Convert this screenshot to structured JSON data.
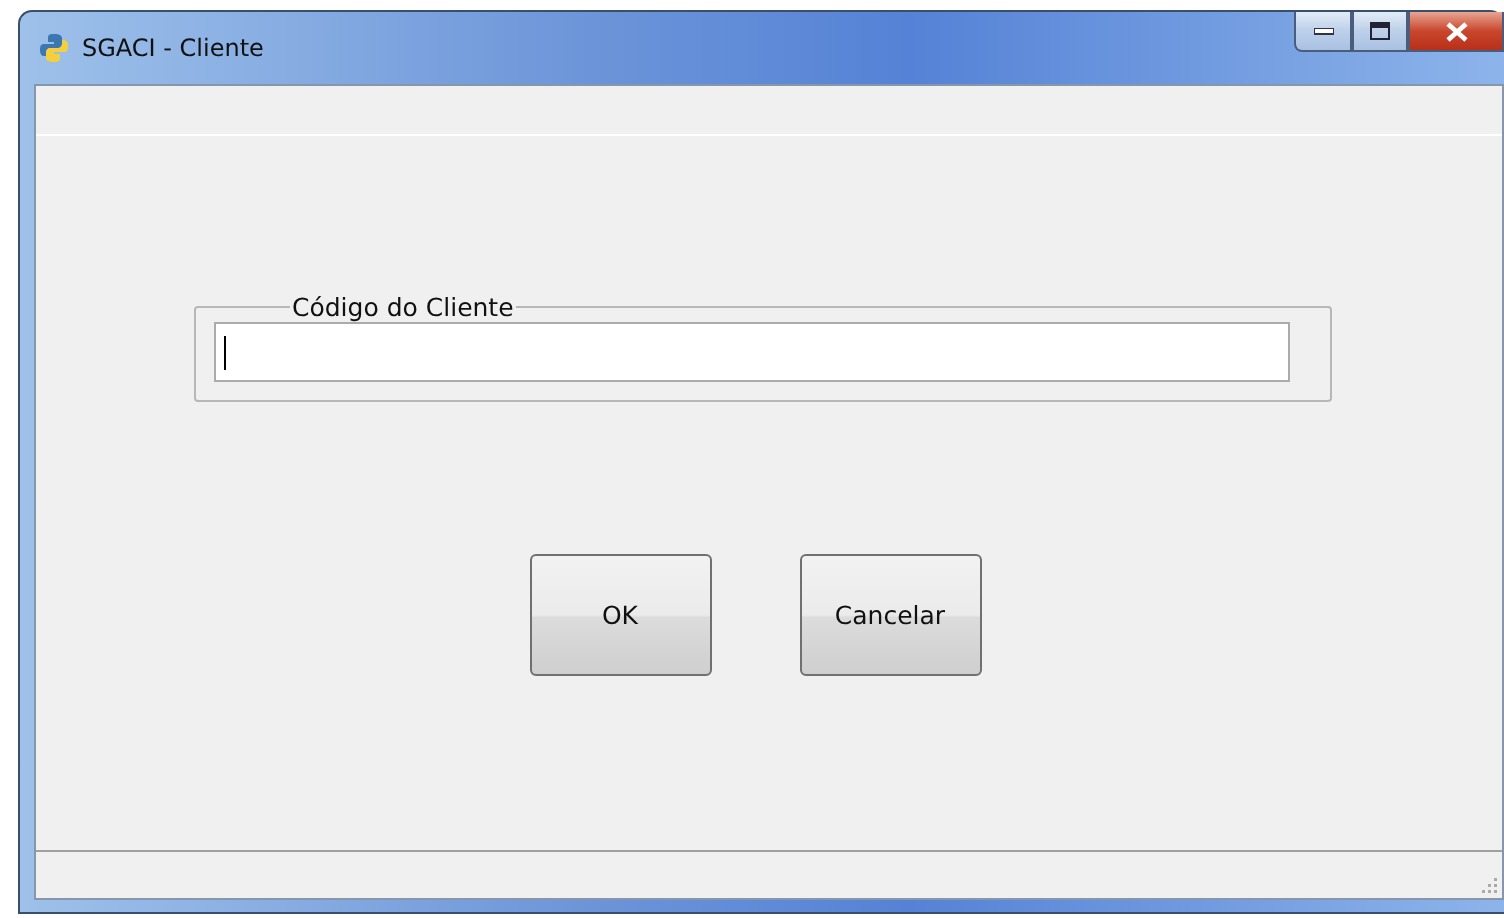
{
  "window": {
    "title": "SGACI - Cliente"
  },
  "group": {
    "label": "Código do Cliente",
    "field": {
      "focused": true
    }
  },
  "buttons": [
    {
      "label": "OK"
    },
    {
      "label": "Cancelar"
    }
  ]
}
